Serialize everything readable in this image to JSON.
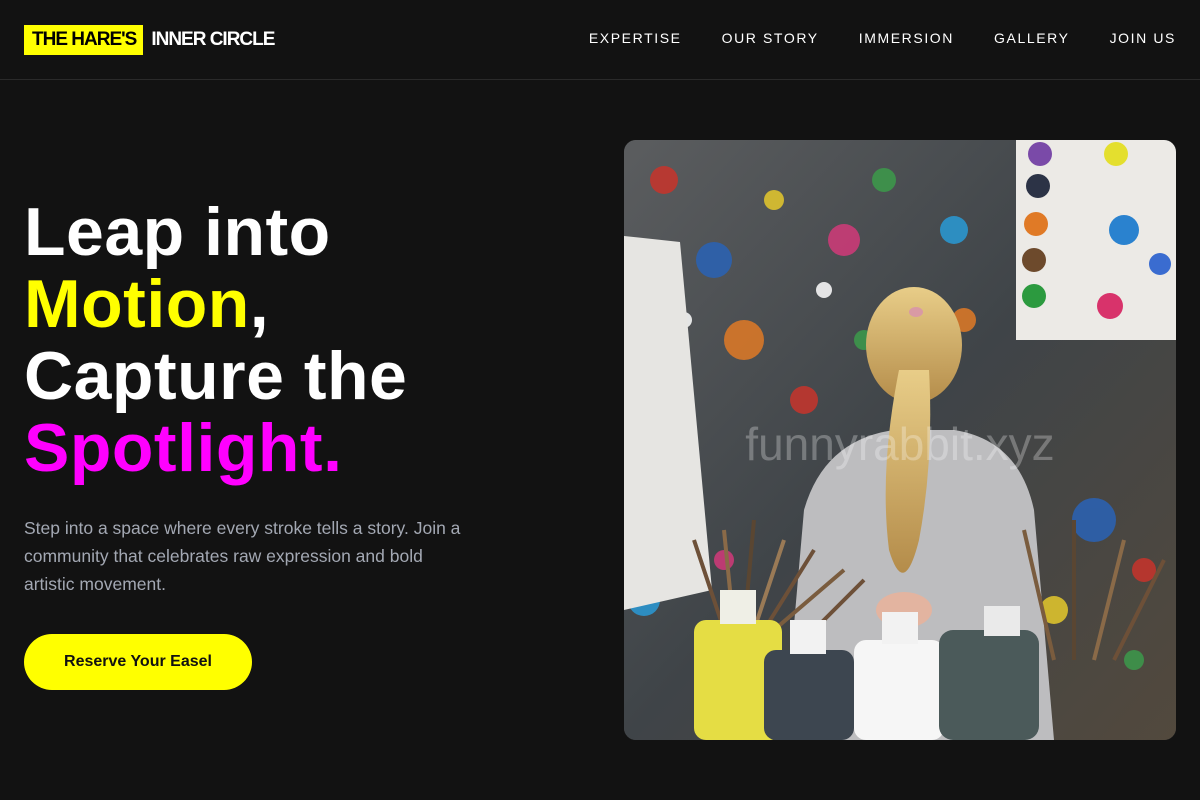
{
  "brand": {
    "badge": "THE HARE'S",
    "name": "INNER CIRCLE"
  },
  "nav": {
    "items": [
      {
        "label": "EXPERTISE"
      },
      {
        "label": "OUR STORY"
      },
      {
        "label": "IMMERSION"
      },
      {
        "label": "GALLERY"
      },
      {
        "label": "JOIN US"
      }
    ]
  },
  "hero": {
    "line1": "Leap into",
    "line2_accent": "Motion",
    "line2_rest": ",",
    "line3": "Capture the",
    "line4_accent": "Spotlight.",
    "subtext": "Step into a space where every stroke tells a story. Join a community that celebrates raw expression and bold artistic movement.",
    "cta_label": "Reserve Your Easel"
  },
  "image": {
    "watermark": "funnyrabbit.xyz"
  },
  "colors": {
    "background": "#121212",
    "accent_yellow": "#ffff00",
    "accent_magenta": "#ff00ff",
    "subtext": "#a3a8b3"
  }
}
